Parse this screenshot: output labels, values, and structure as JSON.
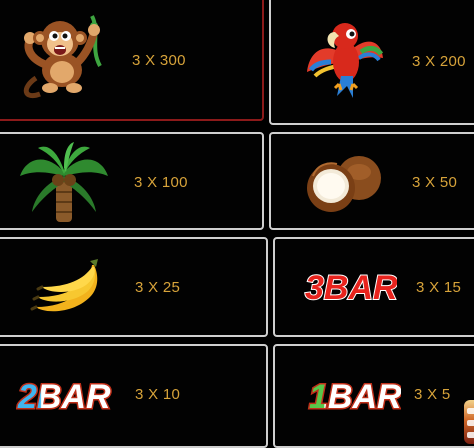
{
  "paytable": {
    "items": [
      {
        "symbol_icon": "monkey-icon",
        "payout": "3 X 300",
        "selected": true
      },
      {
        "symbol_icon": "parrot-icon",
        "payout": "3 X 200"
      },
      {
        "symbol_icon": "palm-tree-icon",
        "payout": "3 X 100"
      },
      {
        "symbol_icon": "coconut-icon",
        "payout": "3 X 50"
      },
      {
        "symbol_icon": "banana-icon",
        "payout": "3 X 25"
      },
      {
        "symbol_icon": "3bar-icon",
        "payout": "3 X 15",
        "logo_text": "3BAR"
      },
      {
        "symbol_icon": "2bar-icon",
        "payout": "3 X 10",
        "logo_text": "2BAR"
      },
      {
        "symbol_icon": "1bar-icon",
        "payout": "3 X 5",
        "logo_text": "1BAR"
      }
    ]
  },
  "colors": {
    "payout_text": "#d7a33a",
    "cell_border": "#cfcfcf",
    "selected_border": "#8c1a1a"
  }
}
